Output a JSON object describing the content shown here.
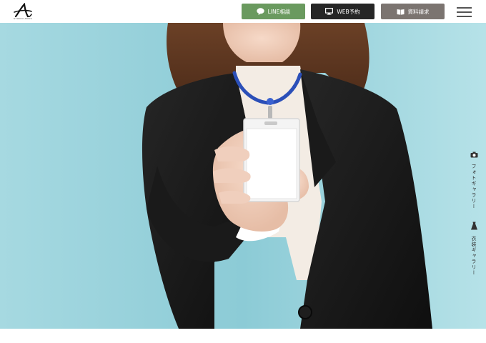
{
  "header": {
    "logo_subtext": "STUDIO AMAS",
    "buttons": {
      "line": "LINE相談",
      "web": "WEB予約",
      "doc": "資料請求"
    },
    "menu_icon": "hamburger-icon"
  },
  "side_nav": {
    "photo_gallery": "フォトギャラリー",
    "costume_gallery": "衣装ギャラリー"
  },
  "colors": {
    "line_button": "#6a9a5f",
    "web_button": "#262626",
    "doc_button": "#7b7470",
    "hero_background": "#9fd3dc"
  }
}
